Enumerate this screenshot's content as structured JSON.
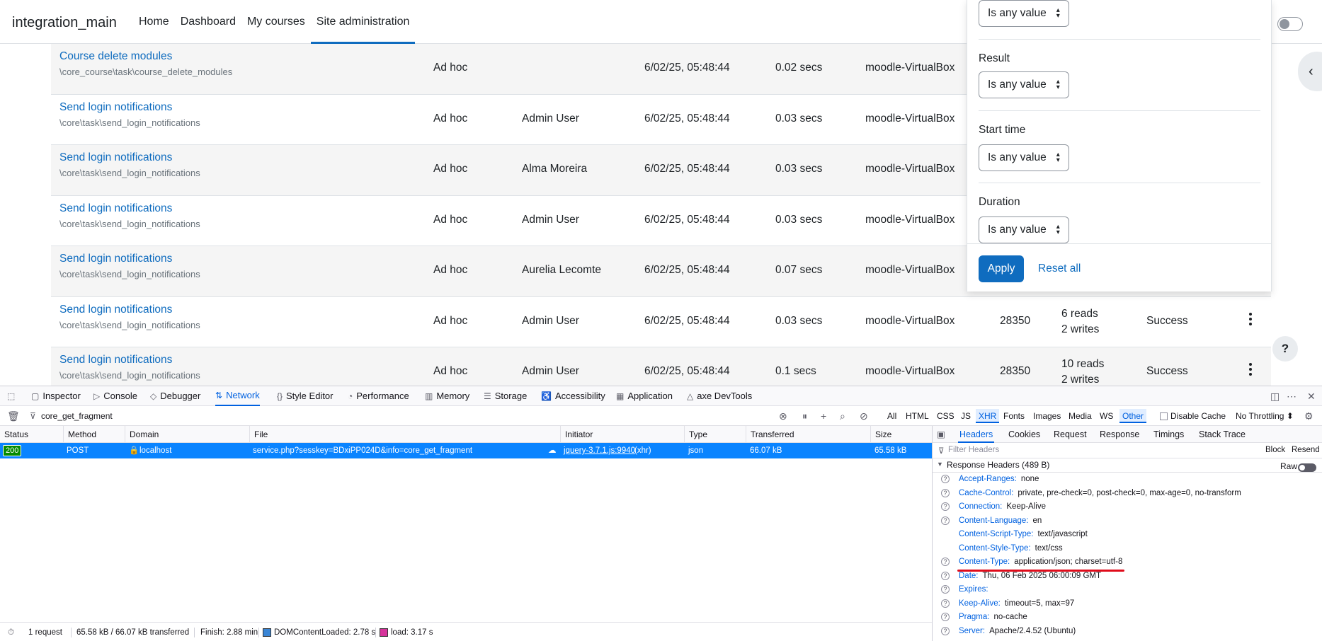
{
  "navbar": {
    "site_name": "integration_main",
    "links": [
      "Home",
      "Dashboard",
      "My courses",
      "Site administration"
    ]
  },
  "tasks": [
    {
      "name": "Course delete modules",
      "class": "\\core_course\\task\\course_delete_modules",
      "type": "Ad hoc",
      "user": "",
      "time": "6/02/25, 05:48:44",
      "duration": "0.02 secs",
      "host": "moodle-VirtualBox",
      "pid": "",
      "db1": "",
      "db2": "",
      "result": ""
    },
    {
      "name": "Send login notifications",
      "class": "\\core\\task\\send_login_notifications",
      "type": "Ad hoc",
      "user": "Admin User",
      "time": "6/02/25, 05:48:44",
      "duration": "0.03 secs",
      "host": "moodle-VirtualBox",
      "pid": "",
      "db1": "",
      "db2": "",
      "result": ""
    },
    {
      "name": "Send login notifications",
      "class": "\\core\\task\\send_login_notifications",
      "type": "Ad hoc",
      "user": "Alma Moreira",
      "time": "6/02/25, 05:48:44",
      "duration": "0.03 secs",
      "host": "moodle-VirtualBox",
      "pid": "",
      "db1": "",
      "db2": "",
      "result": ""
    },
    {
      "name": "Send login notifications",
      "class": "\\core\\task\\send_login_notifications",
      "type": "Ad hoc",
      "user": "Admin User",
      "time": "6/02/25, 05:48:44",
      "duration": "0.03 secs",
      "host": "moodle-VirtualBox",
      "pid": "",
      "db1": "",
      "db2": "",
      "result": ""
    },
    {
      "name": "Send login notifications",
      "class": "\\core\\task\\send_login_notifications",
      "type": "Ad hoc",
      "user": "Aurelia Lecomte",
      "time": "6/02/25, 05:48:44",
      "duration": "0.07 secs",
      "host": "moodle-VirtualBox",
      "pid": "",
      "db1": "",
      "db2": "",
      "result": ""
    },
    {
      "name": "Send login notifications",
      "class": "\\core\\task\\send_login_notifications",
      "type": "Ad hoc",
      "user": "Admin User",
      "time": "6/02/25, 05:48:44",
      "duration": "0.03 secs",
      "host": "moodle-VirtualBox",
      "pid": "28350",
      "db1": "6 reads",
      "db2": "2 writes",
      "result": "Success"
    },
    {
      "name": "Send login notifications",
      "class": "\\core\\task\\send_login_notifications",
      "type": "Ad hoc",
      "user": "Admin User",
      "time": "6/02/25, 05:48:44",
      "duration": "0.1 secs",
      "host": "moodle-VirtualBox",
      "pid": "28350",
      "db1": "10 reads",
      "db2": "2 writes",
      "result": "Success"
    }
  ],
  "filters": {
    "top_select": "Is any value",
    "groups": [
      {
        "label": "Result",
        "value": "Is any value"
      },
      {
        "label": "Start time",
        "value": "Is any value"
      },
      {
        "label": "Duration",
        "value": "Is any value"
      }
    ],
    "apply_label": "Apply",
    "reset_label": "Reset all"
  },
  "help_label": "?",
  "devtools": {
    "tabs": [
      "Inspector",
      "Console",
      "Debugger",
      "Network",
      "Style Editor",
      "Performance",
      "Memory",
      "Storage",
      "Accessibility",
      "Application",
      "axe DevTools"
    ],
    "selected_tab": "Network",
    "url_filter": "core_get_fragment",
    "type_filters": [
      "All",
      "HTML",
      "CSS",
      "JS",
      "XHR",
      "Fonts",
      "Images",
      "Media",
      "WS",
      "Other"
    ],
    "disable_cache_label": "Disable Cache",
    "throttling": "No Throttling",
    "columns": [
      "Status",
      "Method",
      "Domain",
      "File",
      "Initiator",
      "Type",
      "Transferred",
      "Size"
    ],
    "request": {
      "status": "200",
      "method": "POST",
      "domain": "localhost",
      "file": "service.php?sesskey=BDxiPP024D&info=core_get_fragment",
      "initiator": "jquery-3.7.1.js:9940",
      "initiator_suffix": "(xhr)",
      "type": "json",
      "transferred": "66.07 kB",
      "size": "65.58 kB"
    },
    "status_bar": {
      "requests": "1 request",
      "sizes": "65.58 kB / 66.07 kB transferred",
      "finish": "Finish: 2.88 min",
      "dcl": "DOMContentLoaded: 2.78 s",
      "load": "load: 3.17 s"
    },
    "detail_tabs": [
      "Headers",
      "Cookies",
      "Request",
      "Response",
      "Timings",
      "Stack Trace"
    ],
    "filter_headers_placeholder": "Filter Headers",
    "block_label": "Block",
    "resend_label": "Resend",
    "response_headers_title": "Response Headers (489 B)",
    "raw_label": "Raw",
    "headers": [
      {
        "name": "Accept-Ranges:",
        "value": "none",
        "help": true
      },
      {
        "name": "Cache-Control:",
        "value": "private, pre-check=0, post-check=0, max-age=0, no-transform",
        "help": true
      },
      {
        "name": "Connection:",
        "value": "Keep-Alive",
        "help": true
      },
      {
        "name": "Content-Language:",
        "value": "en",
        "help": true
      },
      {
        "name": "Content-Script-Type:",
        "value": "text/javascript",
        "help": false
      },
      {
        "name": "Content-Style-Type:",
        "value": "text/css",
        "help": false
      },
      {
        "name": "Content-Type:",
        "value": "application/json; charset=utf-8",
        "help": true
      },
      {
        "name": "Date:",
        "value": "Thu, 06 Feb 2025 06:00:09 GMT",
        "help": true
      },
      {
        "name": "Expires:",
        "value": "",
        "help": true
      },
      {
        "name": "Keep-Alive:",
        "value": "timeout=5, max=97",
        "help": true
      },
      {
        "name": "Pragma:",
        "value": "no-cache",
        "help": true
      },
      {
        "name": "Server:",
        "value": "Apache/2.4.52 (Ubuntu)",
        "help": true
      }
    ],
    "colors": {
      "accent": "#0061e0",
      "selected_row": "#0a84ff",
      "highlight": "#e00b1a",
      "dcl": "#3a86d6",
      "load": "#d6339b"
    }
  }
}
